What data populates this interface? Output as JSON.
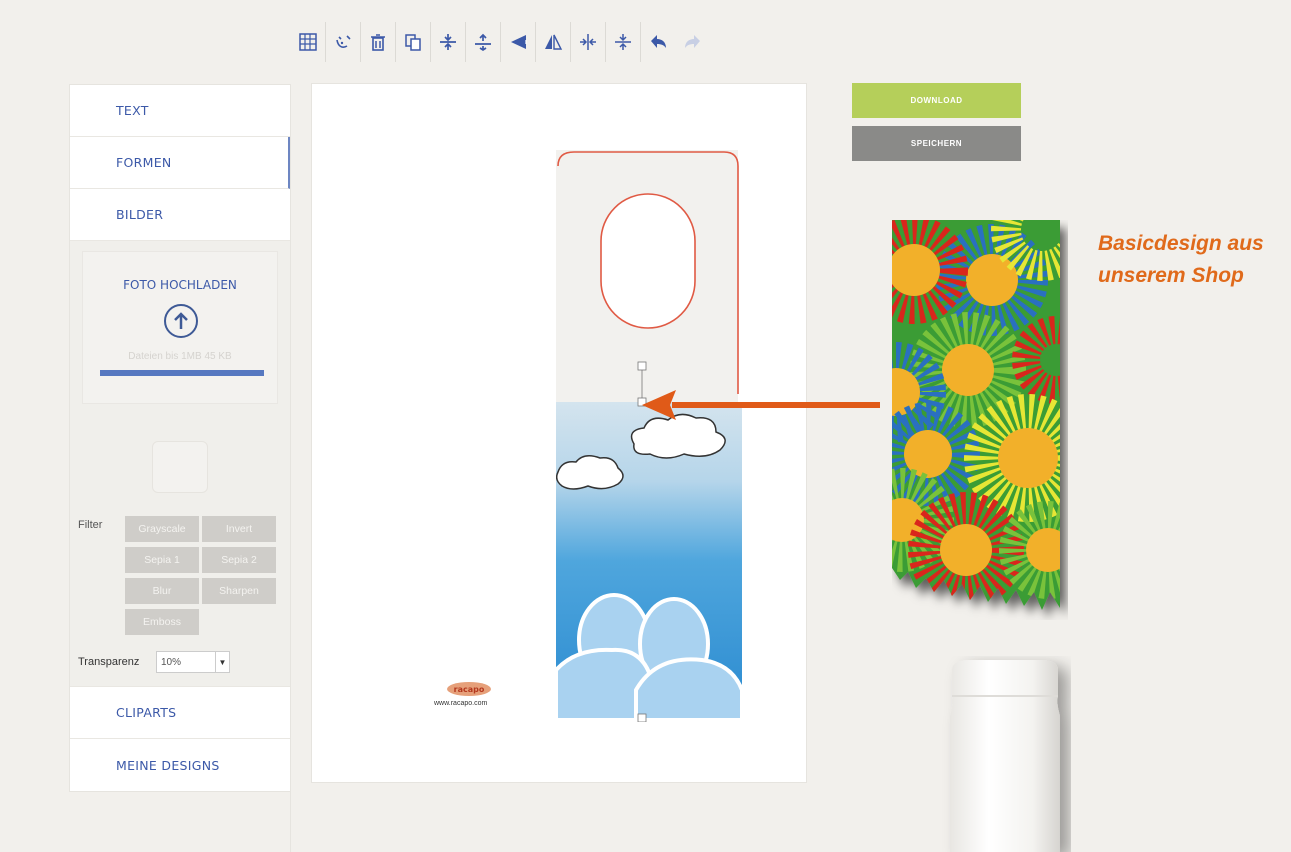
{
  "toolbar": {
    "tools": [
      {
        "name": "grid-icon"
      },
      {
        "name": "clear-icon"
      },
      {
        "name": "trash-icon"
      },
      {
        "name": "copy-icon"
      },
      {
        "name": "align-middle-icon"
      },
      {
        "name": "align-center-icon"
      },
      {
        "name": "flip-horizontal-icon"
      },
      {
        "name": "flip-vertical-icon"
      },
      {
        "name": "center-horizontal-icon"
      },
      {
        "name": "center-vertical-icon"
      },
      {
        "name": "undo-icon"
      },
      {
        "name": "redo-icon"
      }
    ]
  },
  "sidebar": {
    "items": [
      {
        "label": "TEXT"
      },
      {
        "label": "FORMEN"
      },
      {
        "label": "BILDER"
      },
      {
        "label": "CLIPARTS"
      },
      {
        "label": "MEINE DESIGNS"
      }
    ],
    "upload": {
      "title": "FOTO HOCHLADEN",
      "hint": "Dateien bis 1MB 45 KB",
      "progress": 1.0
    },
    "filter": {
      "label": "Filter",
      "buttons": [
        "Grayscale",
        "Invert",
        "Sepia 1",
        "Sepia 2",
        "Blur",
        "Sharpen",
        "Emboss"
      ]
    },
    "transparency": {
      "label": "Transparenz",
      "value": "10%"
    }
  },
  "canvas": {
    "logo_text": "racapo",
    "logo_url": "www.racapo.com"
  },
  "actions": {
    "download_label": "DOWNLOAD",
    "save_label": "SPEICHERN"
  },
  "annotation": {
    "text_line1": "Basicdesign aus",
    "text_line2": "unserem Shop"
  },
  "colors": {
    "accent_blue": "#3c59a8",
    "download_green": "#b5cf5a",
    "save_gray": "#8a8a88",
    "annotation_orange": "#e06a1b",
    "hanger_outline": "#e05a44"
  }
}
